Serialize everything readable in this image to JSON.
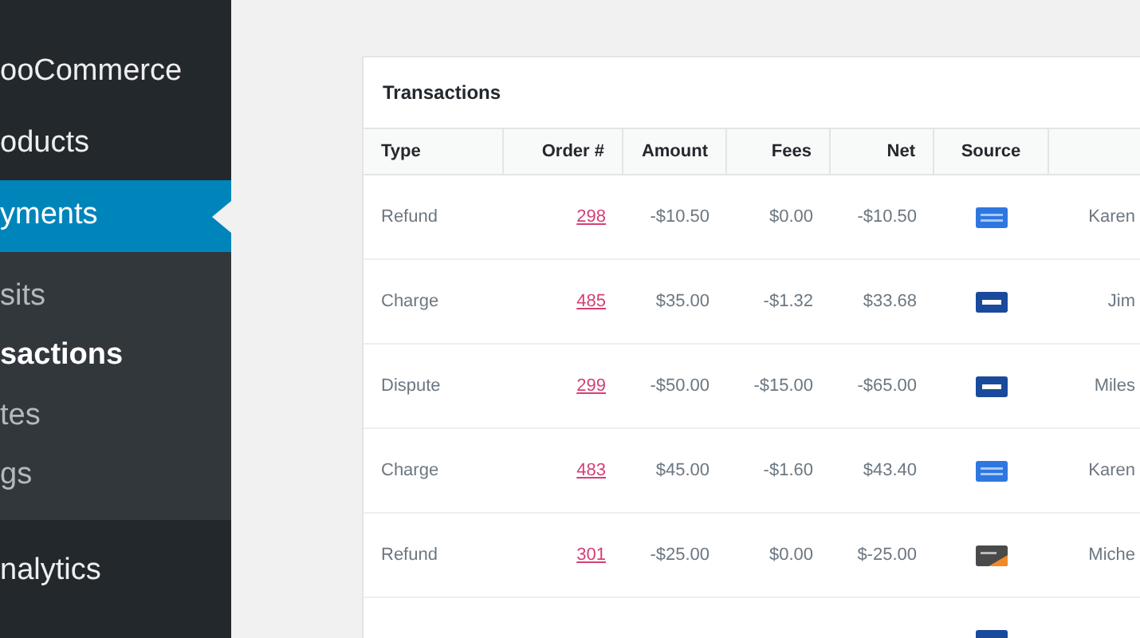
{
  "sidebar": {
    "items": [
      {
        "label": "ooCommerce",
        "selected": false
      },
      {
        "label": "oducts",
        "selected": false
      },
      {
        "label": "yments",
        "selected": true,
        "children": [
          {
            "label": "sits",
            "selected": false
          },
          {
            "label": "sactions",
            "selected": true
          },
          {
            "label": "tes",
            "selected": false
          },
          {
            "label": "gs",
            "selected": false
          }
        ]
      },
      {
        "label": "nalytics",
        "selected": false
      }
    ]
  },
  "card": {
    "title": "Transactions"
  },
  "table": {
    "columns": [
      "Type",
      "Order #",
      "Amount",
      "Fees",
      "Net",
      "Source"
    ],
    "rows": [
      {
        "type": "Refund",
        "order": "298",
        "amount": "-$10.50",
        "fees": "$0.00",
        "net": "-$10.50",
        "kind": "amex",
        "customer": "Karen"
      },
      {
        "type": "Charge",
        "order": "485",
        "amount": "$35.00",
        "fees": "-$1.32",
        "net": "$33.68",
        "kind": "visa",
        "customer": "Jim"
      },
      {
        "type": "Dispute",
        "order": "299",
        "amount": "-$50.00",
        "fees": "-$15.00",
        "net": "-$65.00",
        "kind": "visa",
        "customer": "Miles"
      },
      {
        "type": "Charge",
        "order": "483",
        "amount": "$45.00",
        "fees": "-$1.60",
        "net": "$43.40",
        "kind": "amex",
        "customer": "Karen"
      },
      {
        "type": "Refund",
        "order": "301",
        "amount": "-$25.00",
        "fees": "$0.00",
        "net": "$-25.00",
        "kind": "discover",
        "customer": "Miche"
      },
      {
        "kind": "visa"
      }
    ]
  }
}
